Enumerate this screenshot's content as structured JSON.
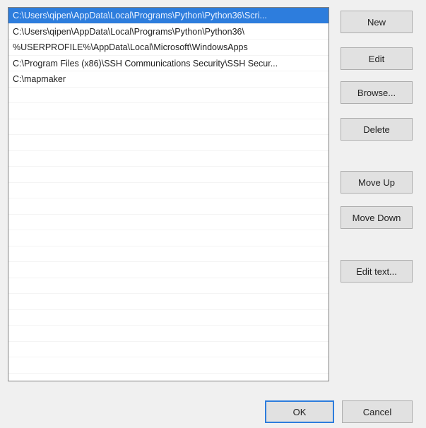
{
  "header": {
    "partial_label": ""
  },
  "list": {
    "items": [
      {
        "label": "C:\\Users\\qipen\\AppData\\Local\\Programs\\Python\\Python36\\Scri...",
        "selected": true
      },
      {
        "label": "C:\\Users\\qipen\\AppData\\Local\\Programs\\Python\\Python36\\",
        "selected": false
      },
      {
        "label": "%USERPROFILE%\\AppData\\Local\\Microsoft\\WindowsApps",
        "selected": false
      },
      {
        "label": "C:\\Program Files (x86)\\SSH Communications Security\\SSH Secur...",
        "selected": false
      },
      {
        "label": "C:\\mapmaker",
        "selected": false
      },
      {
        "label": "",
        "selected": false
      },
      {
        "label": "",
        "selected": false
      },
      {
        "label": "",
        "selected": false
      },
      {
        "label": "",
        "selected": false
      },
      {
        "label": "",
        "selected": false
      },
      {
        "label": "",
        "selected": false
      },
      {
        "label": "",
        "selected": false
      },
      {
        "label": "",
        "selected": false
      },
      {
        "label": "",
        "selected": false
      },
      {
        "label": "",
        "selected": false
      },
      {
        "label": "",
        "selected": false
      },
      {
        "label": "",
        "selected": false
      },
      {
        "label": "",
        "selected": false
      },
      {
        "label": "",
        "selected": false
      },
      {
        "label": "",
        "selected": false
      },
      {
        "label": "",
        "selected": false
      },
      {
        "label": "",
        "selected": false
      },
      {
        "label": "",
        "selected": false
      },
      {
        "label": "",
        "selected": false
      }
    ]
  },
  "buttons": {
    "new": "New",
    "edit": "Edit",
    "browse": "Browse...",
    "delete": "Delete",
    "move_up": "Move Up",
    "move_down": "Move Down",
    "edit_text": "Edit text...",
    "ok": "OK",
    "cancel": "Cancel"
  },
  "colors": {
    "selection": "#2d7ddd",
    "dialog_background": "#f0f0f0",
    "button_face": "#e1e1e1",
    "button_border": "#adadad",
    "default_button_border": "#2d7ddd"
  }
}
